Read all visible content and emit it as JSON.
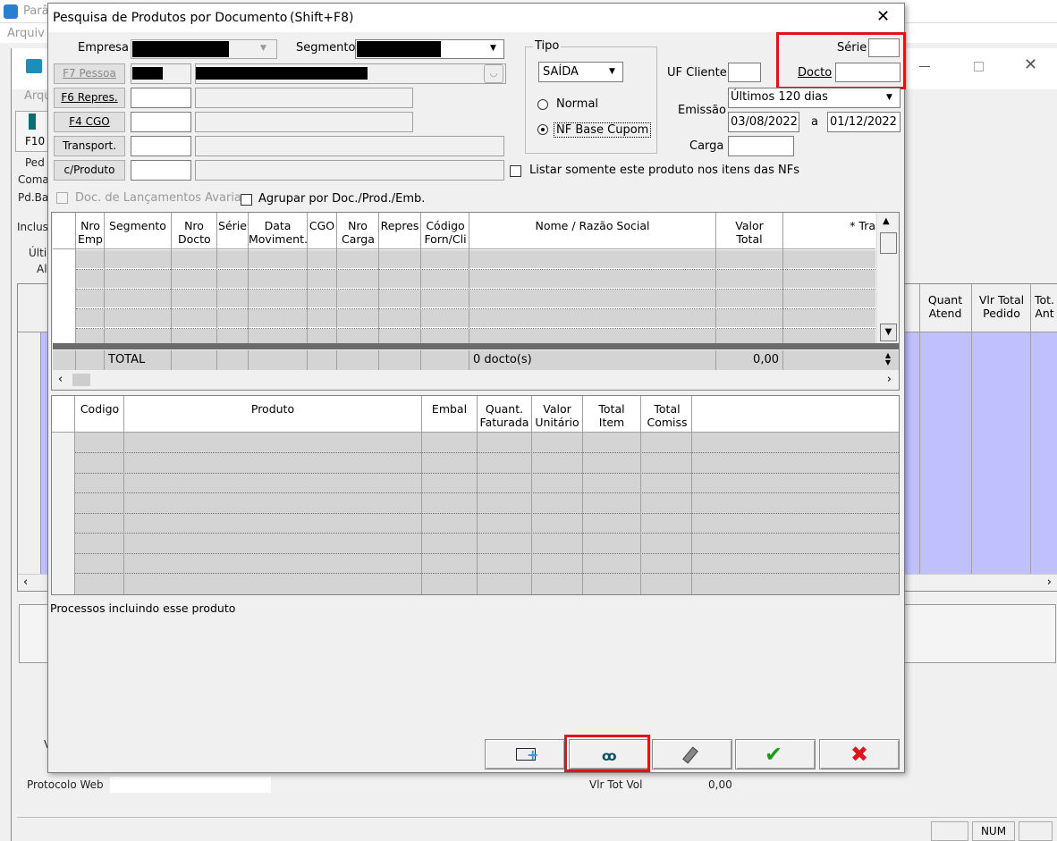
{
  "background": {
    "title_fragment": "Parâ",
    "menu_fragment": "Arquiv",
    "arq_fragment": "Arqu",
    "f10": "F10",
    "ped": "Ped",
    "coma": "Coma",
    "pdba": "Pd.Ba",
    "inclus": "Inclus",
    "ulti": "Últir",
    "al": "Al",
    "col_quant_atend": "Quant Atend",
    "col_vlr_total_pedido": "Vlr Total Pedido",
    "col_tot_ant": "Tot. Ant",
    "protocolo_web": "Protocolo Web",
    "vlr_tot_vol": "Vlr Tot Vol",
    "vlr_tot_vol_value": "0,00",
    "status_num": "NUM",
    "v_fragment": "V"
  },
  "dialog": {
    "title": "Pesquisa de Produtos por Documento",
    "shortcut": "(Shift+F8)",
    "labels": {
      "empresa": "Empresa",
      "segmento": "Segmento",
      "tipo": "Tipo",
      "uf_cliente": "UF Cliente",
      "serie": "Série",
      "docto": "Docto",
      "emissao": "Emissão",
      "carga": "Carga",
      "a": "a",
      "listar_somente": "Listar somente este produto nos itens das NFs",
      "doc_lanc_avaria": "Doc. de Lançamentos Avaria",
      "agrupar": "Agrupar por Doc./Prod./Emb.",
      "processos": "Processos incluindo esse produto"
    },
    "buttons": {
      "pessoa": "F7  Pessoa",
      "repres": "F6  Repres.",
      "cgo": "F4  CGO",
      "transport": "Transport.",
      "cproduto": "c/Produto"
    },
    "tipo": {
      "selected": "SAÍDA",
      "normal": "Normal",
      "nf_base_cupom": "NF Base Cupom"
    },
    "emissao": {
      "period": "Últimos 120 dias",
      "date_from": "03/08/2022",
      "date_to": "01/12/2022"
    },
    "grid1": {
      "columns": [
        {
          "label": "Nro Emp"
        },
        {
          "label": "Segmento"
        },
        {
          "label": "Nro Docto"
        },
        {
          "label": "Série"
        },
        {
          "label": "Data Moviment."
        },
        {
          "label": "CGO"
        },
        {
          "label": "Nro Carga"
        },
        {
          "label": "Repres"
        },
        {
          "label": "Código Forn/Cli"
        },
        {
          "label": "Nome / Razão Social"
        },
        {
          "label": "Valor Total"
        },
        {
          "label": "* Tra"
        }
      ],
      "footer": {
        "total_label": "TOTAL",
        "docto_count": "0 docto(s)",
        "valor_total": "0,00"
      }
    },
    "grid2": {
      "columns": [
        {
          "label": "Codigo"
        },
        {
          "label": "Produto"
        },
        {
          "label": "Embal"
        },
        {
          "label": "Quant. Faturada"
        },
        {
          "label": "Valor Unitário"
        },
        {
          "label": "Total Item"
        },
        {
          "label": "Total Comiss"
        }
      ]
    }
  },
  "colors": {
    "highlight": "#e0121c",
    "selected_rows": "#c0c0ff",
    "ok_green": "#1a9c1a",
    "cancel_red": "#e0121c"
  }
}
